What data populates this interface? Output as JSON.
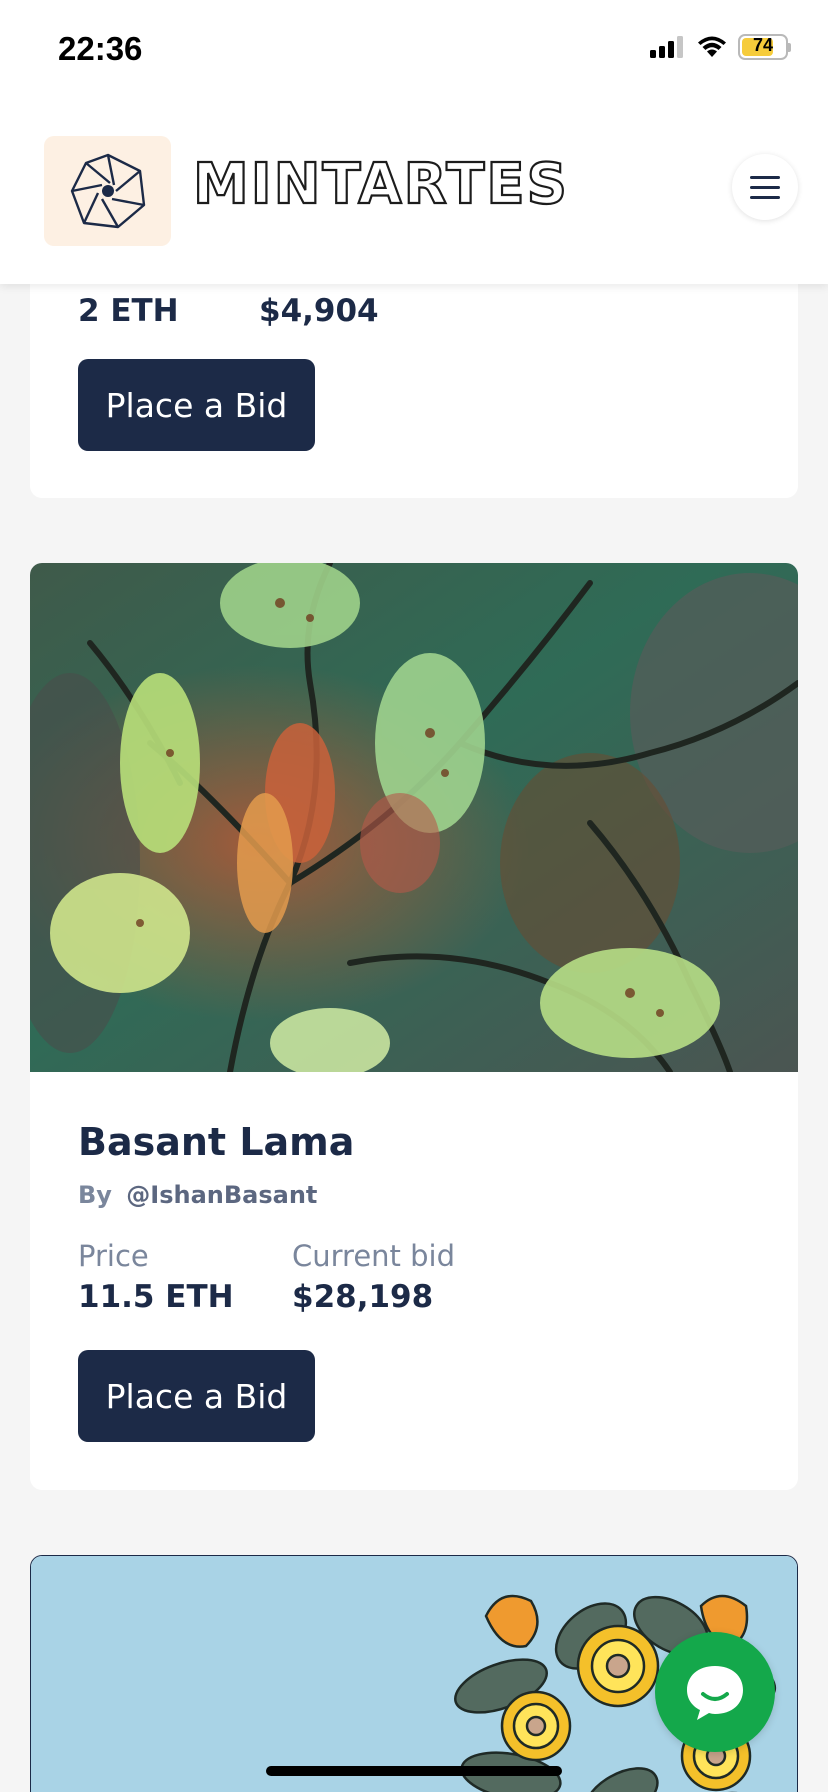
{
  "status_bar": {
    "time": "22:36",
    "battery": "74",
    "icons": [
      "signal-icon",
      "wifi-icon",
      "battery-charging-icon"
    ]
  },
  "header": {
    "brand": "MINTARTES",
    "logo_icon": "aperture-logo-icon",
    "menu_icon": "hamburger-menu-icon"
  },
  "cards": [
    {
      "price_value": "2 ETH",
      "current_bid_value": "$4,904",
      "button_label": "Place a Bid"
    },
    {
      "title": "Basant Lama",
      "by_label": "By",
      "artist": "@IshanBasant",
      "price_label": "Price",
      "price_value": "11.5 ETH",
      "current_bid_label": "Current bid",
      "current_bid_value": "$28,198",
      "button_label": "Place a Bid"
    }
  ],
  "chat": {
    "icon": "chat-bubble-icon"
  },
  "colors": {
    "primary": "#1c2a47",
    "muted": "#7a869c",
    "logo_bg": "#fdf0e3",
    "chat_green": "#14a84b",
    "art2_bg": "#a9d3e6"
  }
}
